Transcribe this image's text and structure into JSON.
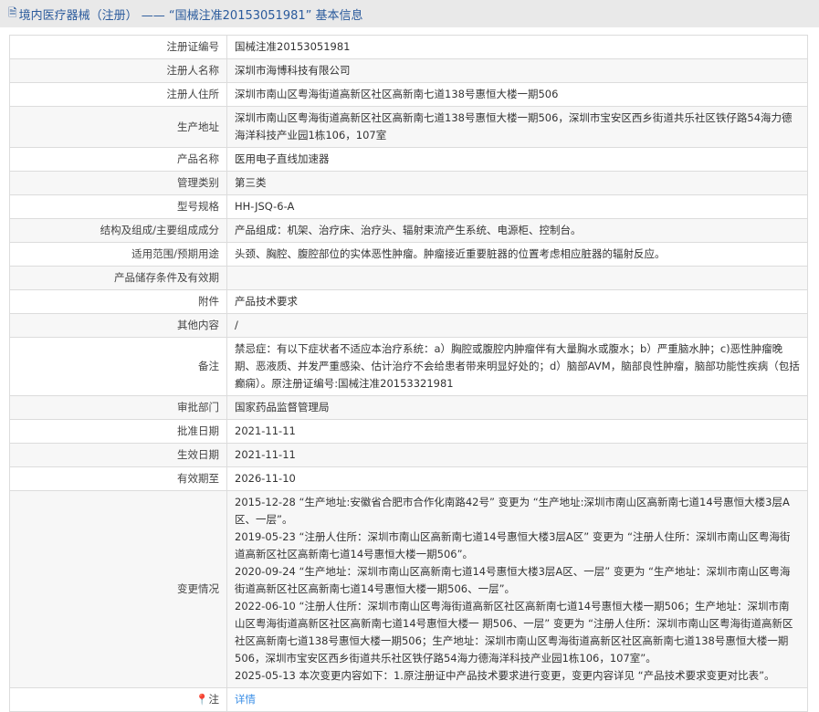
{
  "header": {
    "icon": "document-icon",
    "title": "境内医疗器械（注册）  ——  “国械注准20153051981” 基本信息"
  },
  "rows": [
    {
      "label": "注册证编号",
      "value": "国械注准20153051981"
    },
    {
      "label": "注册人名称",
      "value": "深圳市海博科技有限公司"
    },
    {
      "label": "注册人住所",
      "value": "深圳市南山区粤海街道高新区社区高新南七道138号惠恒大楼一期506"
    },
    {
      "label": "生产地址",
      "value": "深圳市南山区粤海街道高新区社区高新南七道138号惠恒大楼一期506，深圳市宝安区西乡街道共乐社区铁仔路54海力德海洋科技产业园1栋106，107室"
    },
    {
      "label": "产品名称",
      "value": "医用电子直线加速器"
    },
    {
      "label": "管理类别",
      "value": "第三类"
    },
    {
      "label": "型号规格",
      "value": "HH-JSQ-6-A"
    },
    {
      "label": "结构及组成/主要组成成分",
      "value": "产品组成：机架、治疗床、治疗头、辐射束流产生系统、电源柜、控制台。"
    },
    {
      "label": "适用范围/预期用途",
      "value": "头颈、胸腔、腹腔部位的实体恶性肿瘤。肿瘤接近重要脏器的位置考虑相应脏器的辐射反应。"
    },
    {
      "label": "产品储存条件及有效期",
      "value": ""
    },
    {
      "label": "附件",
      "value": "产品技术要求"
    },
    {
      "label": "其他内容",
      "value": "/"
    },
    {
      "label": "备注",
      "value": "禁忌症：有以下症状者不适应本治疗系统：a）胸腔或腹腔内肿瘤伴有大量胸水或腹水；b）严重脑水肿；c)恶性肿瘤晚期、恶液质、并发严重感染、估计治疗不会给患者带来明显好处的；d）脑部AVM，脑部良性肿瘤，脑部功能性疾病（包括癫痫）。原注册证编号:国械注准20153321981"
    },
    {
      "label": "审批部门",
      "value": "国家药品监督管理局"
    },
    {
      "label": "批准日期",
      "value": "2021-11-11"
    },
    {
      "label": "生效日期",
      "value": "2021-11-11"
    },
    {
      "label": "有效期至",
      "value": "2026-11-10"
    }
  ],
  "changes": {
    "label": "变更情况",
    "items": [
      "2015-12-28 “生产地址:安徽省合肥市合作化南路42号” 变更为 “生产地址:深圳市南山区高新南七道14号惠恒大楼3层A区、一层”。",
      "2019-05-23 “注册人住所：深圳市南山区高新南七道14号惠恒大楼3层A区” 变更为 “注册人住所：深圳市南山区粤海街道高新区社区高新南七道14号惠恒大楼一期506”。",
      "2020-09-24 “生产地址：深圳市南山区高新南七道14号惠恒大楼3层A区、一层” 变更为 “生产地址：深圳市南山区粤海街道高新区社区高新南七道14号惠恒大楼一期506、一层”。",
      "2022-06-10 “注册人住所：深圳市南山区粤海街道高新区社区高新南七道14号惠恒大楼一期506；生产地址：深圳市南山区粤海街道高新区社区高新南七道14号惠恒大楼一 期506、一层” 变更为 “注册人住所：深圳市南山区粤海街道高新区社区高新南七道138号惠恒大楼一期506；生产地址：深圳市南山区粤海街道高新区社区高新南七道138号惠恒大楼一期506，深圳市宝安区西乡街道共乐社区铁仔路54海力德海洋科技产业园1栋106，107室”。",
      "2025-05-13 本次变更内容如下：1.原注册证中产品技术要求进行变更，变更内容详见 “产品技术要求变更对比表”。"
    ]
  },
  "note": {
    "icon": "map-pin-icon",
    "label": "注",
    "link": "详情"
  }
}
